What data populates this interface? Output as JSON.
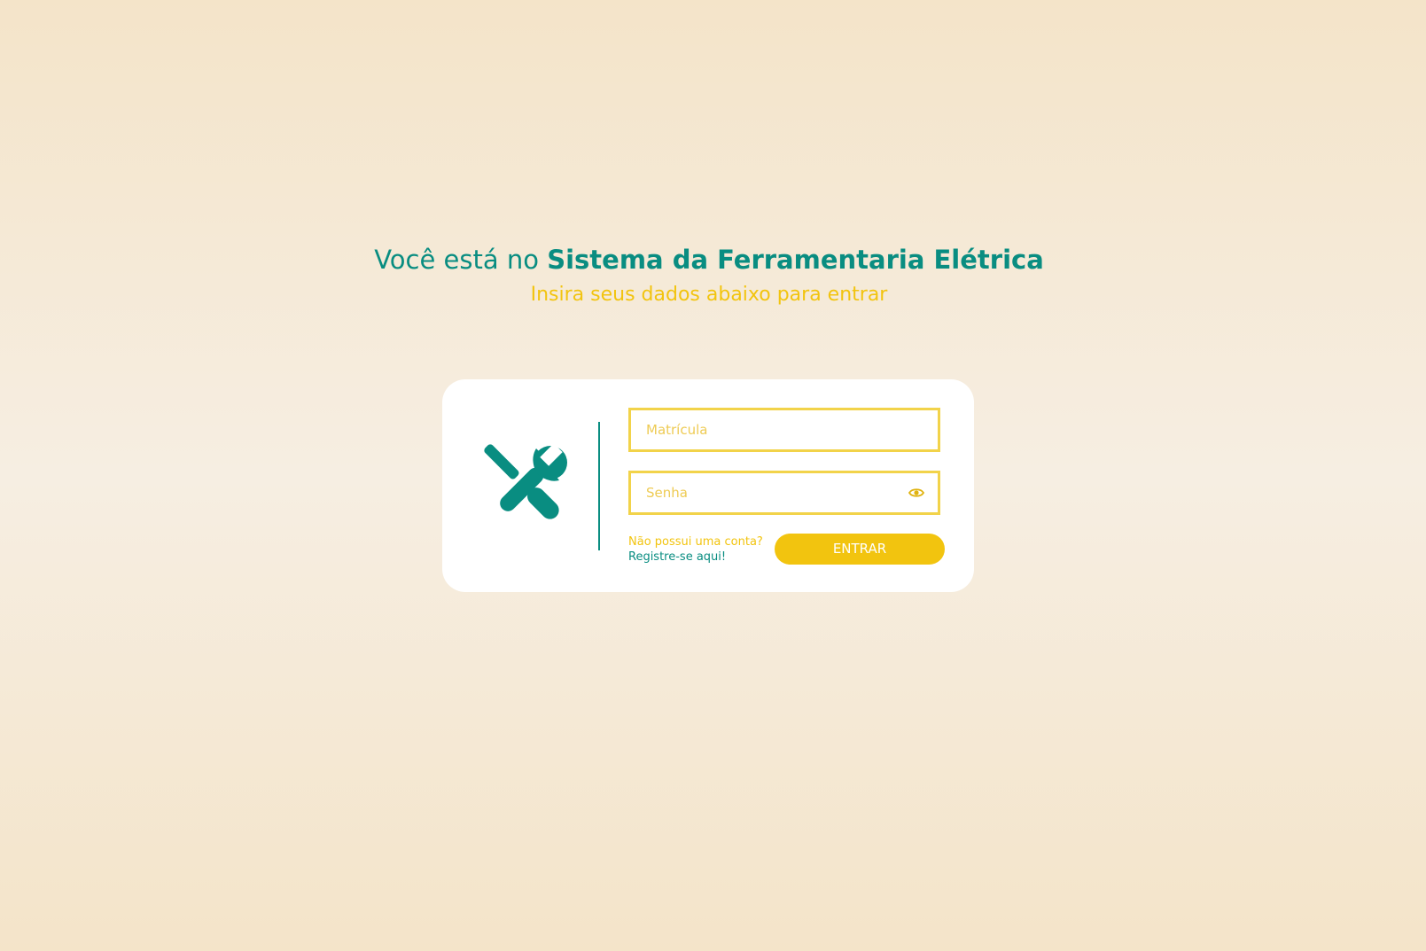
{
  "header": {
    "title_prefix": "Você está no ",
    "title_brand": "Sistema da Ferramentaria Elétrica",
    "subtitle": "Insira seus dados abaixo para entrar"
  },
  "login": {
    "logo_icon": "tools-icon",
    "username_placeholder": "Matrícula",
    "password_placeholder": "Senha",
    "password_toggle_icon": "eye-icon",
    "register_question": "Não possui uma conta?",
    "register_link": "Registre-se aqui!",
    "submit_label": "ENTRAR"
  },
  "colors": {
    "primary": "#098d81",
    "accent": "#f2c40f",
    "field_border": "#f2d34a"
  }
}
